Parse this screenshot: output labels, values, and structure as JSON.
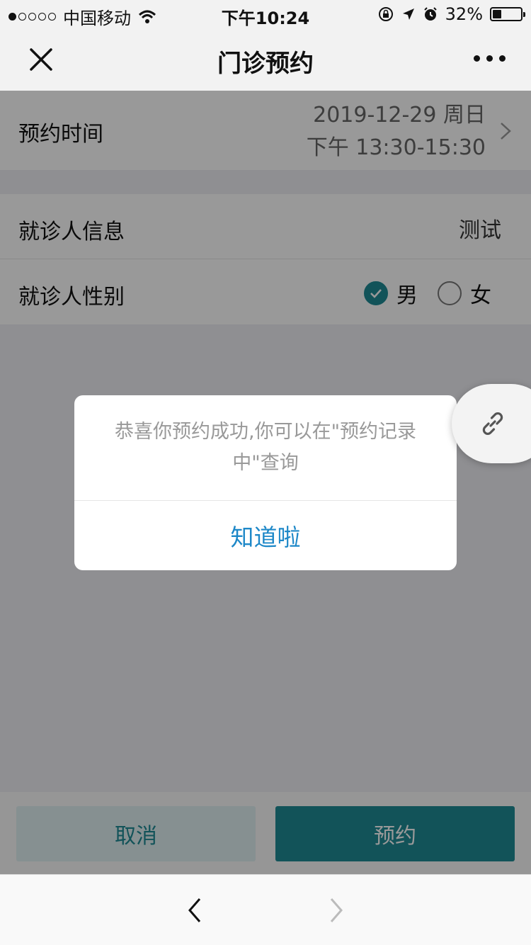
{
  "status_bar": {
    "carrier": "中国移动",
    "time": "下午10:24",
    "battery": "32%",
    "battery_level": 0.32
  },
  "nav": {
    "title": "门诊预约"
  },
  "form": {
    "time_label": "预约时间",
    "time_date": "2019-12-29 周日",
    "time_slot": "下午 13:30-15:30",
    "patient_label": "就诊人信息",
    "patient_value": "测试",
    "gender_label": "就诊人性别",
    "gender_options": [
      "男",
      "女"
    ],
    "gender_selected": "男"
  },
  "buttons": {
    "cancel": "取消",
    "book": "预约"
  },
  "dialog": {
    "message": "恭喜你预约成功,你可以在\"预约记录中\"查询",
    "confirm": "知道啦"
  },
  "colors": {
    "accent": "#1f8a95",
    "dialog_button": "#1e88c8"
  }
}
